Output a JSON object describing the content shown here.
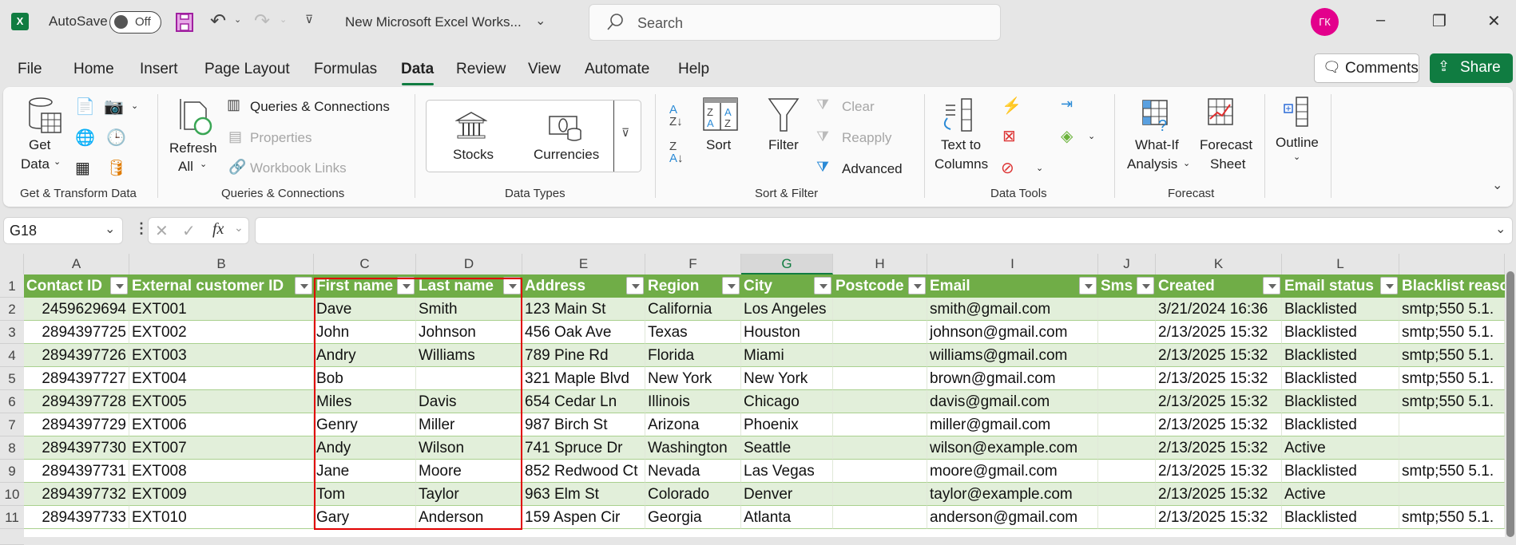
{
  "titlebar": {
    "autosave_label": "AutoSave",
    "autosave_state": "Off",
    "doc_title": "New Microsoft Excel Works...",
    "search_placeholder": "Search",
    "avatar_initials": "ГК",
    "minimize": "–",
    "restore": "❐",
    "close": "✕"
  },
  "menu": {
    "items": [
      "File",
      "Home",
      "Insert",
      "Page Layout",
      "Formulas",
      "Data",
      "Review",
      "View",
      "Automate",
      "Help"
    ],
    "active": "Data",
    "comments_label": "Comments",
    "share_label": "Share"
  },
  "ribbon": {
    "get_transform": {
      "get_data_line1": "Get",
      "get_data_line2": "Data",
      "group_label": "Get & Transform Data"
    },
    "queries": {
      "refresh_line1": "Refresh",
      "refresh_line2": "All",
      "queries_connections": "Queries & Connections",
      "properties": "Properties",
      "workbook_links": "Workbook Links",
      "group_label": "Queries & Connections"
    },
    "data_types": {
      "stocks": "Stocks",
      "currencies": "Currencies",
      "group_label": "Data Types"
    },
    "sort_filter": {
      "sort": "Sort",
      "filter": "Filter",
      "clear": "Clear",
      "reapply": "Reapply",
      "advanced": "Advanced",
      "group_label": "Sort & Filter"
    },
    "data_tools": {
      "text_to_line1": "Text to",
      "text_to_line2": "Columns",
      "group_label": "Data Tools"
    },
    "forecast": {
      "whatif_line1": "What-If",
      "whatif_line2": "Analysis",
      "forecast_line1": "Forecast",
      "forecast_line2": "Sheet",
      "group_label": "Forecast"
    },
    "outline": {
      "label": "Outline"
    }
  },
  "formula_bar": {
    "name_box": "G18",
    "formula": ""
  },
  "sheet": {
    "columns": [
      "A",
      "B",
      "C",
      "D",
      "E",
      "F",
      "G",
      "H",
      "I",
      "J",
      "K",
      "L",
      ""
    ],
    "selected_column": "G",
    "rows": [
      "1",
      "2",
      "3",
      "4",
      "5",
      "6",
      "7",
      "8",
      "9",
      "10",
      "11"
    ],
    "headers": [
      "Contact ID",
      "External customer ID",
      "First name",
      "Last name",
      "Address",
      "Region",
      "City",
      "Postcode",
      "Email",
      "Sms",
      "Created",
      "Email status",
      "Blacklist reaso"
    ],
    "data": [
      [
        "2459629694",
        "EXT001",
        "Dave",
        "Smith",
        "123 Main St",
        "California",
        "Los Angeles",
        "",
        "smith@gmail.com",
        "",
        "3/21/2024 16:36",
        "Blacklisted",
        "smtp;550 5.1."
      ],
      [
        "2894397725",
        "EXT002",
        "John",
        "Johnson",
        "456 Oak Ave",
        "Texas",
        "Houston",
        "",
        "johnson@gmail.com",
        "",
        "2/13/2025 15:32",
        "Blacklisted",
        "smtp;550 5.1."
      ],
      [
        "2894397726",
        "EXT003",
        "Andry",
        "Williams",
        "789 Pine Rd",
        "Florida",
        "Miami",
        "",
        "williams@gmail.com",
        "",
        "2/13/2025 15:32",
        "Blacklisted",
        "smtp;550 5.1."
      ],
      [
        "2894397727",
        "EXT004",
        "Bob",
        "",
        "321 Maple Blvd",
        "New York",
        "New York",
        "",
        "brown@gmail.com",
        "",
        "2/13/2025 15:32",
        "Blacklisted",
        "smtp;550 5.1."
      ],
      [
        "2894397728",
        "EXT005",
        "Miles",
        "Davis",
        "654 Cedar Ln",
        "Illinois",
        "Chicago",
        "",
        "davis@gmail.com",
        "",
        "2/13/2025 15:32",
        "Blacklisted",
        "smtp;550 5.1."
      ],
      [
        "2894397729",
        "EXT006",
        "Genry",
        "Miller",
        "987 Birch St",
        "Arizona",
        "Phoenix",
        "",
        "miller@gmail.com",
        "",
        "2/13/2025 15:32",
        "Blacklisted",
        ""
      ],
      [
        "2894397730",
        "EXT007",
        "Andy",
        "Wilson",
        "741 Spruce Dr",
        "Washington",
        "Seattle",
        "",
        "wilson@example.com",
        "",
        "2/13/2025 15:32",
        "Active",
        ""
      ],
      [
        "2894397731",
        "EXT008",
        "Jane",
        "Moore",
        "852 Redwood Ct",
        "Nevada",
        "Las Vegas",
        "",
        "moore@gmail.com",
        "",
        "2/13/2025 15:32",
        "Blacklisted",
        "smtp;550 5.1."
      ],
      [
        "2894397732",
        "EXT009",
        "Tom",
        "Taylor",
        "963 Elm St",
        "Colorado",
        "Denver",
        "",
        "taylor@example.com",
        "",
        "2/13/2025 15:32",
        "Active",
        ""
      ],
      [
        "2894397733",
        "EXT010",
        "Gary",
        "Anderson",
        "159 Aspen Cir",
        "Georgia",
        "Atlanta",
        "",
        "anderson@gmail.com",
        "",
        "2/13/2025 15:32",
        "Blacklisted",
        "smtp;550 5.1."
      ]
    ]
  },
  "colors": {
    "accent": "#107c41",
    "table_header": "#70ad47",
    "band": "#e2efda",
    "selection_outline": "#e00000"
  }
}
